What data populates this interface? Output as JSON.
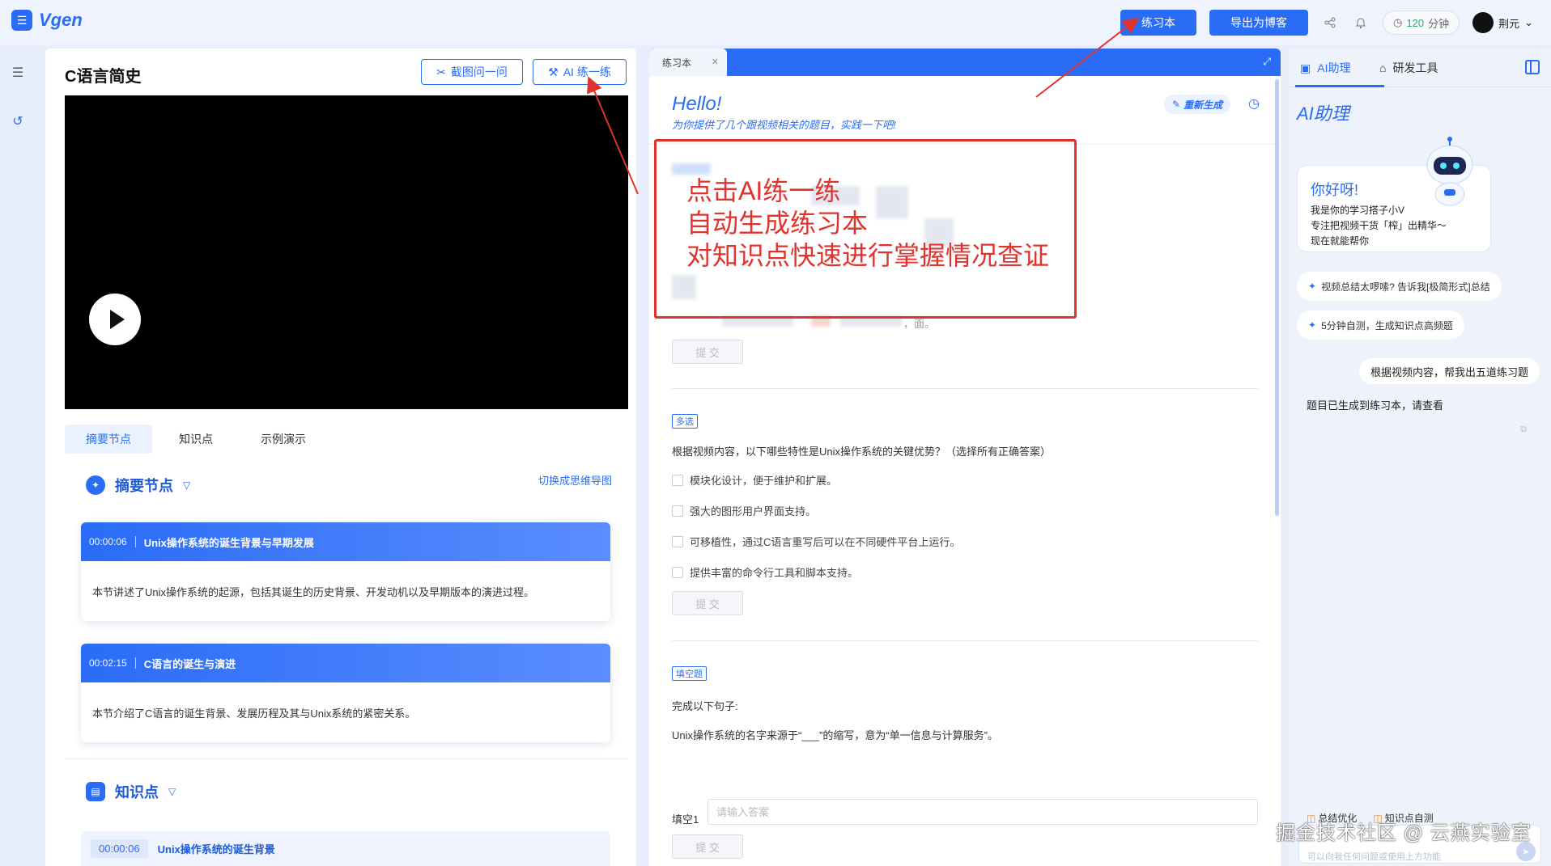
{
  "app": {
    "name": "Vgen"
  },
  "header": {
    "practice_btn": "练习本",
    "export_btn": "导出为博客",
    "time_value": "120",
    "time_unit": "分钟",
    "user_name": "荆元"
  },
  "left": {
    "video_title": "C语言简史",
    "screenshot_ask": "截图问一问",
    "ai_practice": "AI 练一练",
    "tabs": [
      "摘要节点",
      "知识点",
      "示例演示"
    ],
    "summary_title": "摘要节点",
    "switch_mindmap": "切换成思维导图",
    "cards": [
      {
        "time": "00:00:06",
        "title": "Unix操作系统的诞生背景与早期发展",
        "body": "本节讲述了Unix操作系统的起源，包括其诞生的历史背景、开发动机以及早期版本的演进过程。"
      },
      {
        "time": "00:02:15",
        "title": "C语言的诞生与演进",
        "body": "本节介绍了C语言的诞生背景、发展历程及其与Unix系统的紧密关系。"
      }
    ],
    "knowledge_title": "知识点",
    "knowledge_item": {
      "time": "00:00:06",
      "title": "Unix操作系统的诞生背景"
    }
  },
  "middle": {
    "tab_label": "练习本",
    "hello": "Hello!",
    "hello_sub": "为你提供了几个跟视频相关的题目，实践一下吧!",
    "regen": "重新生成",
    "submit": "提 交",
    "q1_tail": "，面。",
    "q2": {
      "tag": "多选",
      "text": "根据视频内容，以下哪些特性是Unix操作系统的关键优势？（选择所有正确答案）",
      "options": [
        "模块化设计，便于维护和扩展。",
        "强大的图形用户界面支持。",
        "可移植性，通过C语言重写后可以在不同硬件平台上运行。",
        "提供丰富的命令行工具和脚本支持。"
      ]
    },
    "q3": {
      "tag": "填空题",
      "prompt": "完成以下句子:",
      "sentence": "Unix操作系统的名字来源于“___”的缩写，意为“单一信息与计算服务”。",
      "fill_label": "填空1",
      "fill_placeholder": "请输入答案"
    }
  },
  "annotation": {
    "lines": [
      "点击AI练一练",
      "自动生成练习本",
      "对知识点快速进行掌握情况查证"
    ],
    "color": "#e0332e"
  },
  "right": {
    "tab_ai": "AI助理",
    "tab_dev": "研发工具",
    "title": "AI助理",
    "greet_title": "你好呀!",
    "greet_lines": [
      "我是你的学习搭子小V",
      "专注把视频干货「榨」出精华～",
      "现在就能帮你"
    ],
    "chips": [
      "视频总结太啰嗦? 告诉我[极简形式]总结",
      "5分钟自测，生成知识点高频题"
    ],
    "user_msg": "根据视频内容，帮我出五道练习题",
    "bot_msg": "题目已生成到练习本，请查看",
    "bottom_chips": [
      "总结优化",
      "知识点自测"
    ],
    "input_placeholder": "可以向我任何问题或使用上方功能"
  },
  "watermark": "掘金技术社区 @ 云燕实验室",
  "colors": {
    "accent": "#2a6cf6",
    "annotation": "#e0332e"
  }
}
